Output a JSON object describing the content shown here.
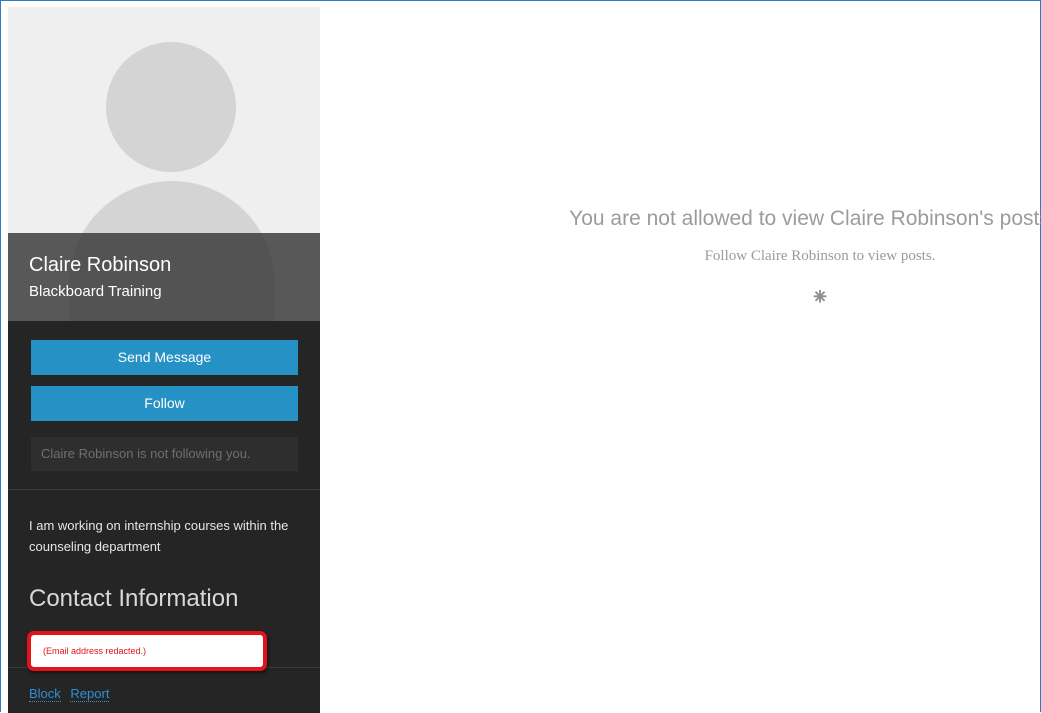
{
  "profile": {
    "name": "Claire Robinson",
    "organization": "Blackboard Training"
  },
  "actions": {
    "send_message_label": "Send Message",
    "follow_label": "Follow"
  },
  "follow_status": "Claire Robinson is not following you.",
  "bio": "I am working on internship courses within the counseling department",
  "contact": {
    "heading": "Contact Information",
    "email_text": "(Email address redacted.)"
  },
  "footer": {
    "block_label": "Block",
    "report_label": "Report"
  },
  "main": {
    "title": "You are not allowed to view Claire Robinson's posts…",
    "subtitle": "Follow Claire Robinson to view posts.",
    "spinner_glyph": "⁕"
  },
  "colors": {
    "accent_button": "#2591c4",
    "sidebar_bg": "#252525",
    "highlight_red": "#e2141b",
    "link": "#2f8fd6"
  },
  "icons": {
    "avatar": "default-avatar-icon",
    "spinner": "loading-spinner-icon"
  }
}
